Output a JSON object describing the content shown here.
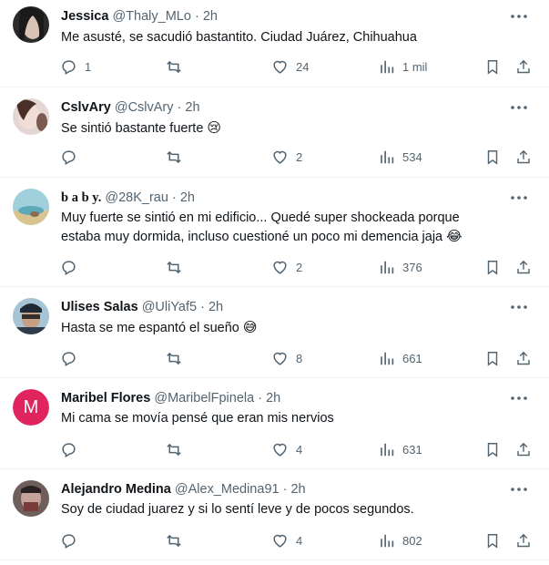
{
  "tweets": [
    {
      "name": "Jessica",
      "handle": "@Thaly_MLo",
      "time": "2h",
      "text": "Me asusté, se sacudió bastantito. Ciudad Juárez, Chihuahua",
      "emoji": "",
      "replies": "1",
      "retweets": "",
      "likes": "24",
      "views": "1 mil",
      "avatar": {
        "type": "photo",
        "colors": [
          "#3a3a3a",
          "#c9b7ad"
        ]
      }
    },
    {
      "name": "CslvAry",
      "handle": "@CslvAry",
      "time": "2h",
      "text": "Se sintió bastante fuerte",
      "emoji": "😢",
      "replies": "",
      "retweets": "",
      "likes": "2",
      "views": "534",
      "avatar": {
        "type": "photo",
        "colors": [
          "#d8c6c0",
          "#6b4a40"
        ]
      }
    },
    {
      "name": "b a b y.",
      "handle": "@28K_rau",
      "time": "2h",
      "text": "Muy fuerte se sintió en mi edificio... Quedé super shockeada porque estaba muy dormida, incluso cuestioné un poco mi demencia jaja",
      "emoji": "😂",
      "replies": "",
      "retweets": "",
      "likes": "2",
      "views": "376",
      "avatar": {
        "type": "photo",
        "colors": [
          "#7fb7c9",
          "#c9b88a"
        ]
      }
    },
    {
      "name": "Ulises Salas",
      "handle": "@UliYaf5",
      "time": "2h",
      "text": "Hasta se me espantó el sueño",
      "emoji": "😅",
      "replies": "",
      "retweets": "",
      "likes": "8",
      "views": "661",
      "avatar": {
        "type": "photo",
        "colors": [
          "#2f3b4a",
          "#8fb3c7"
        ]
      }
    },
    {
      "name": "Maribel Flores",
      "handle": "@MaribelFpinela",
      "time": "2h",
      "text": "Mi cama se movía pensé que eran mis nervios",
      "emoji": "",
      "replies": "",
      "retweets": "",
      "likes": "4",
      "views": "631",
      "avatar": {
        "type": "letter",
        "letter": "M",
        "colors": [
          "#e0245e"
        ]
      }
    },
    {
      "name": "Alejandro Medina",
      "handle": "@Alex_Medina91",
      "time": "2h",
      "text": "Soy de ciudad juarez y si lo sentí leve y de pocos segundos.",
      "emoji": "",
      "replies": "",
      "retweets": "",
      "likes": "4",
      "views": "802",
      "avatar": {
        "type": "photo",
        "colors": [
          "#5a4a4a",
          "#b08f86"
        ]
      }
    }
  ],
  "dot": "·",
  "icons": {
    "reply": "reply-icon",
    "retweet": "retweet-icon",
    "like": "like-icon",
    "views": "views-icon",
    "bookmark": "bookmark-icon",
    "share": "share-icon",
    "more": "more-icon"
  },
  "colors": {
    "text": "#0f1419",
    "secondary": "#536471",
    "divider": "#eff3f4"
  }
}
